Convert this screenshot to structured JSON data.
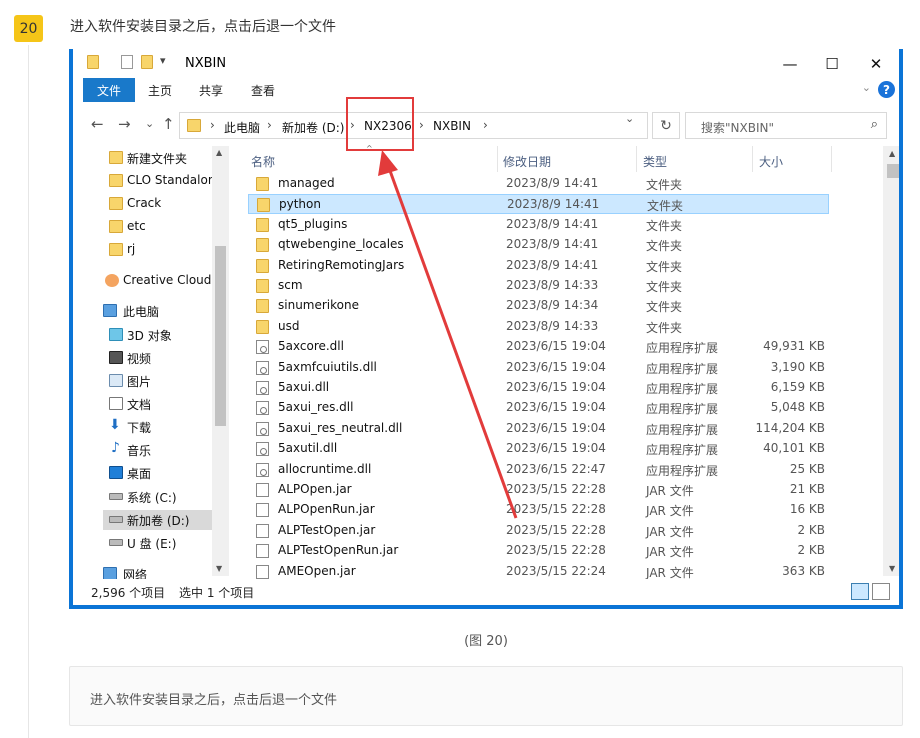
{
  "step": {
    "number": "20",
    "text": "进入软件安装目录之后，点击后退一个文件"
  },
  "window": {
    "title": "NXBIN",
    "controls": {
      "minimize": "—",
      "maximize": "☐",
      "close": "✕"
    },
    "ribbon_tabs": [
      "文件",
      "主页",
      "共享",
      "查看"
    ],
    "help": "?"
  },
  "address": {
    "back": "←",
    "forward": "→",
    "recent": "⌄",
    "up": "↑",
    "crumbs": [
      "此电脑",
      "新加卷 (D:)",
      "NX2306",
      "NXBIN"
    ],
    "refresh": "↻",
    "search_placeholder": "搜索\"NXBIN\"",
    "search_icon": "⌕"
  },
  "nav_pane": {
    "quick_access": [
      "新建文件夹",
      "CLO Standalon",
      "Crack",
      "etc",
      "rj"
    ],
    "creative_cloud": "Creative Cloud F",
    "this_pc": "此电脑",
    "pc_items": [
      "3D 对象",
      "视频",
      "图片",
      "文档",
      "下载",
      "音乐",
      "桌面",
      "系统 (C:)",
      "新加卷 (D:)",
      "U 盘 (E:)"
    ],
    "network": "网络",
    "pin_icon": "pin-icon"
  },
  "columns": {
    "name": "名称",
    "date": "修改日期",
    "type": "类型",
    "size": "大小"
  },
  "files": [
    {
      "name": "managed",
      "date": "2023/8/9 14:41",
      "type": "文件夹",
      "size": "",
      "kind": "folder"
    },
    {
      "name": "python",
      "date": "2023/8/9 14:41",
      "type": "文件夹",
      "size": "",
      "kind": "folder",
      "selected": true
    },
    {
      "name": "qt5_plugins",
      "date": "2023/8/9 14:41",
      "type": "文件夹",
      "size": "",
      "kind": "folder"
    },
    {
      "name": "qtwebengine_locales",
      "date": "2023/8/9 14:41",
      "type": "文件夹",
      "size": "",
      "kind": "folder"
    },
    {
      "name": "RetiringRemotingJars",
      "date": "2023/8/9 14:41",
      "type": "文件夹",
      "size": "",
      "kind": "folder"
    },
    {
      "name": "scm",
      "date": "2023/8/9 14:33",
      "type": "文件夹",
      "size": "",
      "kind": "folder"
    },
    {
      "name": "sinumerikone",
      "date": "2023/8/9 14:34",
      "type": "文件夹",
      "size": "",
      "kind": "folder"
    },
    {
      "name": "usd",
      "date": "2023/8/9 14:33",
      "type": "文件夹",
      "size": "",
      "kind": "folder"
    },
    {
      "name": "5axcore.dll",
      "date": "2023/6/15 19:04",
      "type": "应用程序扩展",
      "size": "49,931 KB",
      "kind": "dll"
    },
    {
      "name": "5axmfcuiutils.dll",
      "date": "2023/6/15 19:04",
      "type": "应用程序扩展",
      "size": "3,190 KB",
      "kind": "dll"
    },
    {
      "name": "5axui.dll",
      "date": "2023/6/15 19:04",
      "type": "应用程序扩展",
      "size": "6,159 KB",
      "kind": "dll"
    },
    {
      "name": "5axui_res.dll",
      "date": "2023/6/15 19:04",
      "type": "应用程序扩展",
      "size": "5,048 KB",
      "kind": "dll"
    },
    {
      "name": "5axui_res_neutral.dll",
      "date": "2023/6/15 19:04",
      "type": "应用程序扩展",
      "size": "114,204 KB",
      "kind": "dll"
    },
    {
      "name": "5axutil.dll",
      "date": "2023/6/15 19:04",
      "type": "应用程序扩展",
      "size": "40,101 KB",
      "kind": "dll"
    },
    {
      "name": "allocruntime.dll",
      "date": "2023/6/15 22:47",
      "type": "应用程序扩展",
      "size": "25 KB",
      "kind": "dll"
    },
    {
      "name": "ALPOpen.jar",
      "date": "2023/5/15 22:28",
      "type": "JAR 文件",
      "size": "21 KB",
      "kind": "jar"
    },
    {
      "name": "ALPOpenRun.jar",
      "date": "2023/5/15 22:28",
      "type": "JAR 文件",
      "size": "16 KB",
      "kind": "jar"
    },
    {
      "name": "ALPTestOpen.jar",
      "date": "2023/5/15 22:28",
      "type": "JAR 文件",
      "size": "2 KB",
      "kind": "jar"
    },
    {
      "name": "ALPTestOpenRun.jar",
      "date": "2023/5/15 22:28",
      "type": "JAR 文件",
      "size": "2 KB",
      "kind": "jar"
    },
    {
      "name": "AMEOpen.jar",
      "date": "2023/5/15 22:24",
      "type": "JAR 文件",
      "size": "363 KB",
      "kind": "jar"
    }
  ],
  "status": {
    "count": "2,596 个项目",
    "selected": "选中 1 个项目"
  },
  "caption": "(图 20)",
  "note": "进入软件安装目录之后，点击后退一个文件",
  "colors": {
    "accent": "#1979ca",
    "highlight": "#e23b3b",
    "badge": "#f5c518",
    "selected_row": "#cce8ff"
  }
}
